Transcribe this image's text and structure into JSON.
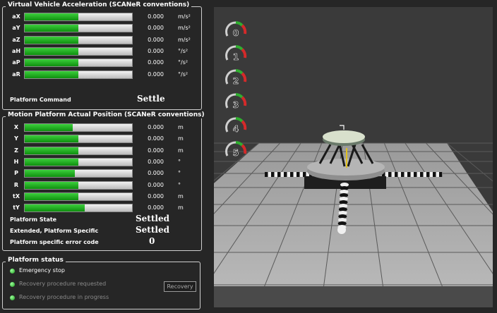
{
  "acc": {
    "title": "Virtual Vehicle Acceleration (SCANeR conventions)",
    "rows": [
      {
        "label": "aX",
        "value": "0.000",
        "unit": "m/s²",
        "level": 0.5
      },
      {
        "label": "aY",
        "value": "0.000",
        "unit": "m/s²",
        "level": 0.5
      },
      {
        "label": "aZ",
        "value": "0.000",
        "unit": "m/s²",
        "level": 0.5
      },
      {
        "label": "aH",
        "value": "0.000",
        "unit": "°/s²",
        "level": 0.5
      },
      {
        "label": "aP",
        "value": "0.000",
        "unit": "°/s²",
        "level": 0.5
      },
      {
        "label": "aR",
        "value": "0.000",
        "unit": "°/s²",
        "level": 0.5
      }
    ],
    "command_label": "Platform Command",
    "command_value": "Settle"
  },
  "pos": {
    "title": "Motion Platform Actual Position (SCANeR conventions)",
    "rows": [
      {
        "label": "X",
        "value": "0.000",
        "unit": "m",
        "level": 0.45
      },
      {
        "label": "Y",
        "value": "0.000",
        "unit": "m",
        "level": 0.5
      },
      {
        "label": "Z",
        "value": "0.000",
        "unit": "m",
        "level": 0.5
      },
      {
        "label": "H",
        "value": "0.000",
        "unit": "°",
        "level": 0.5
      },
      {
        "label": "P",
        "value": "0.000",
        "unit": "°",
        "level": 0.47
      },
      {
        "label": "R",
        "value": "0.000",
        "unit": "°",
        "level": 0.5
      },
      {
        "label": "tX",
        "value": "0.000",
        "unit": "m",
        "level": 0.5
      },
      {
        "label": "tY",
        "value": "0.000",
        "unit": "m",
        "level": 0.56
      }
    ],
    "state_label": "Platform State",
    "state_value": "Settled",
    "ext_label": "Extended, Platform Specific",
    "ext_value": "Settled",
    "err_label": "Platform specific error code",
    "err_value": "0"
  },
  "status": {
    "title": "Platform status",
    "items": [
      {
        "label": "Emergency stop",
        "active": true
      },
      {
        "label": "Recovery procedure requested",
        "active": false
      },
      {
        "label": "Recovery procedure in progress",
        "active": false
      }
    ],
    "recovery_button": "Recovery"
  },
  "gauges": [
    "0",
    "1",
    "2",
    "3",
    "4",
    "5"
  ],
  "colors": {
    "bar_fill": "#22b022",
    "gauge_green": "#2fae2f",
    "gauge_red": "#d42a2a"
  }
}
